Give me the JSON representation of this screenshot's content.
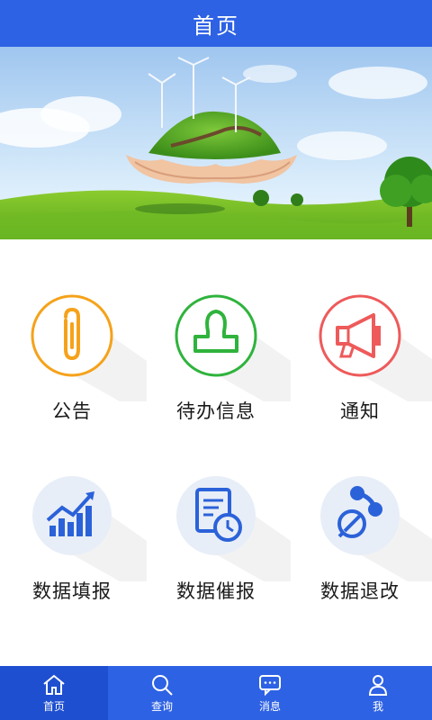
{
  "header": {
    "title": "首页"
  },
  "grid": {
    "items": [
      {
        "label": "公告"
      },
      {
        "label": "待办信息"
      },
      {
        "label": "通知"
      },
      {
        "label": "数据填报"
      },
      {
        "label": "数据催报"
      },
      {
        "label": "数据退改"
      }
    ]
  },
  "tabbar": {
    "items": [
      {
        "label": "首页",
        "icon": "home-icon",
        "active": true
      },
      {
        "label": "查询",
        "icon": "search-icon",
        "active": false
      },
      {
        "label": "消息",
        "icon": "message-icon",
        "active": false
      },
      {
        "label": "我",
        "icon": "user-icon",
        "active": false
      }
    ]
  },
  "colors": {
    "primary": "#2e62e4",
    "tab_active": "#1e4fd0",
    "notice_orange": "#f5a21a",
    "todo_green": "#2fb33c",
    "alert_red": "#ee5a5a",
    "icon_blue": "#2b62d9"
  }
}
